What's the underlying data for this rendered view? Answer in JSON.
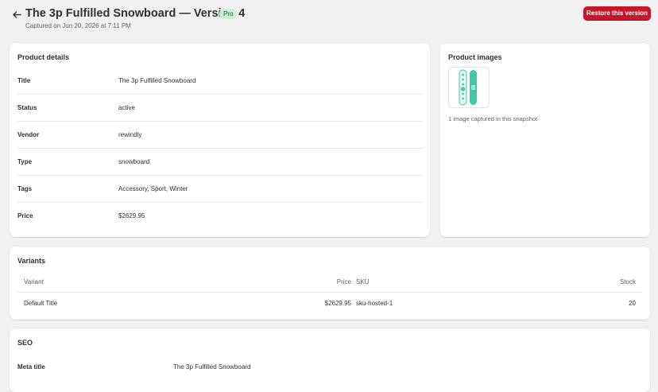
{
  "header": {
    "title": "The 3p Fulfilled Snowboard — Version 4",
    "badge": "Pro",
    "captured": "Captured on Jun 20, 2026 at 7:11 PM",
    "restore_label": "Restore this version"
  },
  "details": {
    "title": "Product details",
    "rows": [
      {
        "label": "Title",
        "value": "The 3p Fulfilled Snowboard"
      },
      {
        "label": "Status",
        "value": "active"
      },
      {
        "label": "Vendor",
        "value": "rewindly"
      },
      {
        "label": "Type",
        "value": "snowboard"
      },
      {
        "label": "Tags",
        "value": "Accessory, Sport, Winter"
      },
      {
        "label": "Price",
        "value": "$2629.95"
      }
    ]
  },
  "images": {
    "title": "Product images",
    "caption": "1 image captured in this snapshot"
  },
  "variants": {
    "title": "Variants",
    "columns": {
      "variant": "Variant",
      "price": "Price",
      "sku": "SKU",
      "stock": "Stock"
    },
    "rows": [
      {
        "variant": "Default Title",
        "price": "$2629.95",
        "sku": "sku-hosted-1",
        "stock": "20"
      }
    ]
  },
  "seo": {
    "title": "SEO",
    "meta_title_label": "Meta title",
    "meta_title_value": "The 3p Fulfilled Snowboard"
  },
  "colors": {
    "accent": "#c5162c",
    "badge_bg": "#c9f4cf",
    "snowboard": "#3ec9a7"
  }
}
